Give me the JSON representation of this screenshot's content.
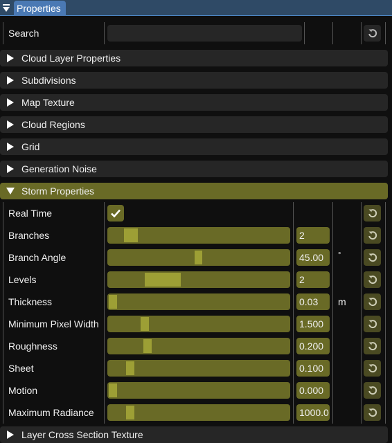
{
  "window": {
    "title": "Properties",
    "collapse_icon": "collapse-arrow-icon"
  },
  "search": {
    "label": "Search",
    "value": "",
    "placeholder": "",
    "reset_icon": "reset-icon"
  },
  "sections": [
    {
      "label": "Cloud Layer Properties",
      "expanded": false
    },
    {
      "label": "Subdivisions",
      "expanded": false
    },
    {
      "label": "Map Texture",
      "expanded": false
    },
    {
      "label": "Cloud Regions",
      "expanded": false
    },
    {
      "label": "Grid",
      "expanded": false
    },
    {
      "label": "Generation Noise",
      "expanded": false
    },
    {
      "label": "Storm Properties",
      "expanded": true
    },
    {
      "label": "Layer Cross Section Texture",
      "expanded": false
    }
  ],
  "storm": {
    "real_time": {
      "label": "Real Time",
      "checked": true
    },
    "properties": [
      {
        "label": "Branches",
        "value": "2",
        "unit": "",
        "slider_fraction": 0.12,
        "grab_fraction": 0.08
      },
      {
        "label": "Branch Angle",
        "value": "45.00",
        "unit": "°",
        "slider_fraction": 0.5,
        "grab_fraction": 0.045
      },
      {
        "label": "Levels",
        "value": "2",
        "unit": "",
        "slider_fraction": 0.3,
        "grab_fraction": 0.2
      },
      {
        "label": "Thickness",
        "value": "0.03",
        "unit": "m",
        "slider_fraction": 0.0,
        "grab_fraction": 0.045
      },
      {
        "label": "Minimum Pixel Width",
        "value": "1.500",
        "unit": "",
        "slider_fraction": 0.2,
        "grab_fraction": 0.045
      },
      {
        "label": "Roughness",
        "value": "0.200",
        "unit": "",
        "slider_fraction": 0.22,
        "grab_fraction": 0.045
      },
      {
        "label": "Sheet",
        "value": "0.100",
        "unit": "",
        "slider_fraction": 0.1,
        "grab_fraction": 0.045
      },
      {
        "label": "Motion",
        "value": "0.000",
        "unit": "",
        "slider_fraction": 0.0,
        "grab_fraction": 0.045
      },
      {
        "label": "Maximum Radiance",
        "value": "1000.0",
        "unit": "",
        "slider_fraction": 0.1,
        "grab_fraction": 0.045
      }
    ]
  },
  "colors": {
    "title_bar": "#2f4a66",
    "title_tab": "#4a79b4",
    "accent": "#696a26",
    "slider_grab": "#9d9f35",
    "section_header": "#262626"
  }
}
